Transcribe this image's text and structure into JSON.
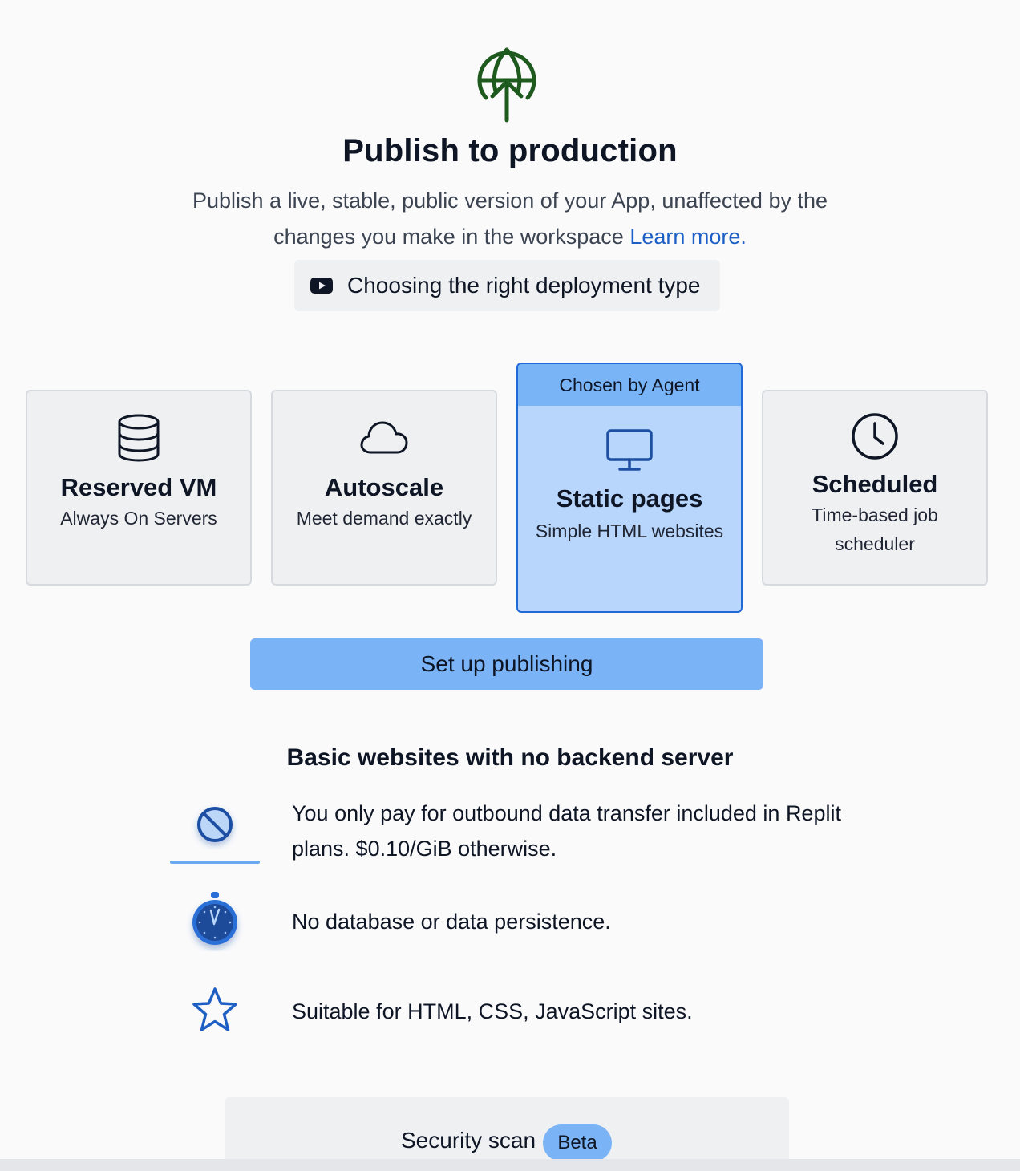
{
  "header": {
    "icon": "globe-upload-icon",
    "title": "Publish to production",
    "subtitle": "Publish a live, stable, public version of your App, unaffected by the changes you make in the workspace",
    "learn_more": "Learn more.",
    "video_button": "Choosing the right deployment type"
  },
  "deployment_types": [
    {
      "icon": "database-icon",
      "title": "Reserved VM",
      "subtitle": "Always On Servers"
    },
    {
      "icon": "cloud-icon",
      "title": "Autoscale",
      "subtitle": "Meet demand exactly"
    },
    {
      "icon": "monitor-icon",
      "title": "Static pages",
      "subtitle": "Simple HTML websites",
      "badge": "Chosen by Agent",
      "selected": true
    },
    {
      "icon": "clock-icon",
      "title": "Scheduled",
      "subtitle": "Time-based job scheduler"
    }
  ],
  "setup_button": "Set up publishing",
  "details": {
    "title": "Basic websites with no backend server",
    "features": [
      {
        "icon": "prohibited-icon",
        "text": "You only pay for outbound data transfer included in Replit plans. $0.10/GiB otherwise."
      },
      {
        "icon": "stopwatch-icon",
        "text": "No database or data persistence."
      },
      {
        "icon": "star-icon",
        "text": "Suitable for HTML, CSS, JavaScript sites."
      }
    ]
  },
  "security": {
    "label": "Security scan",
    "badge": "Beta"
  },
  "colors": {
    "accent": "#7ab4f6",
    "selected_card": "#b8d6fb",
    "selected_border": "#1f6ad6",
    "link": "#1d5fc4",
    "hero_icon": "#1e5a1e"
  }
}
